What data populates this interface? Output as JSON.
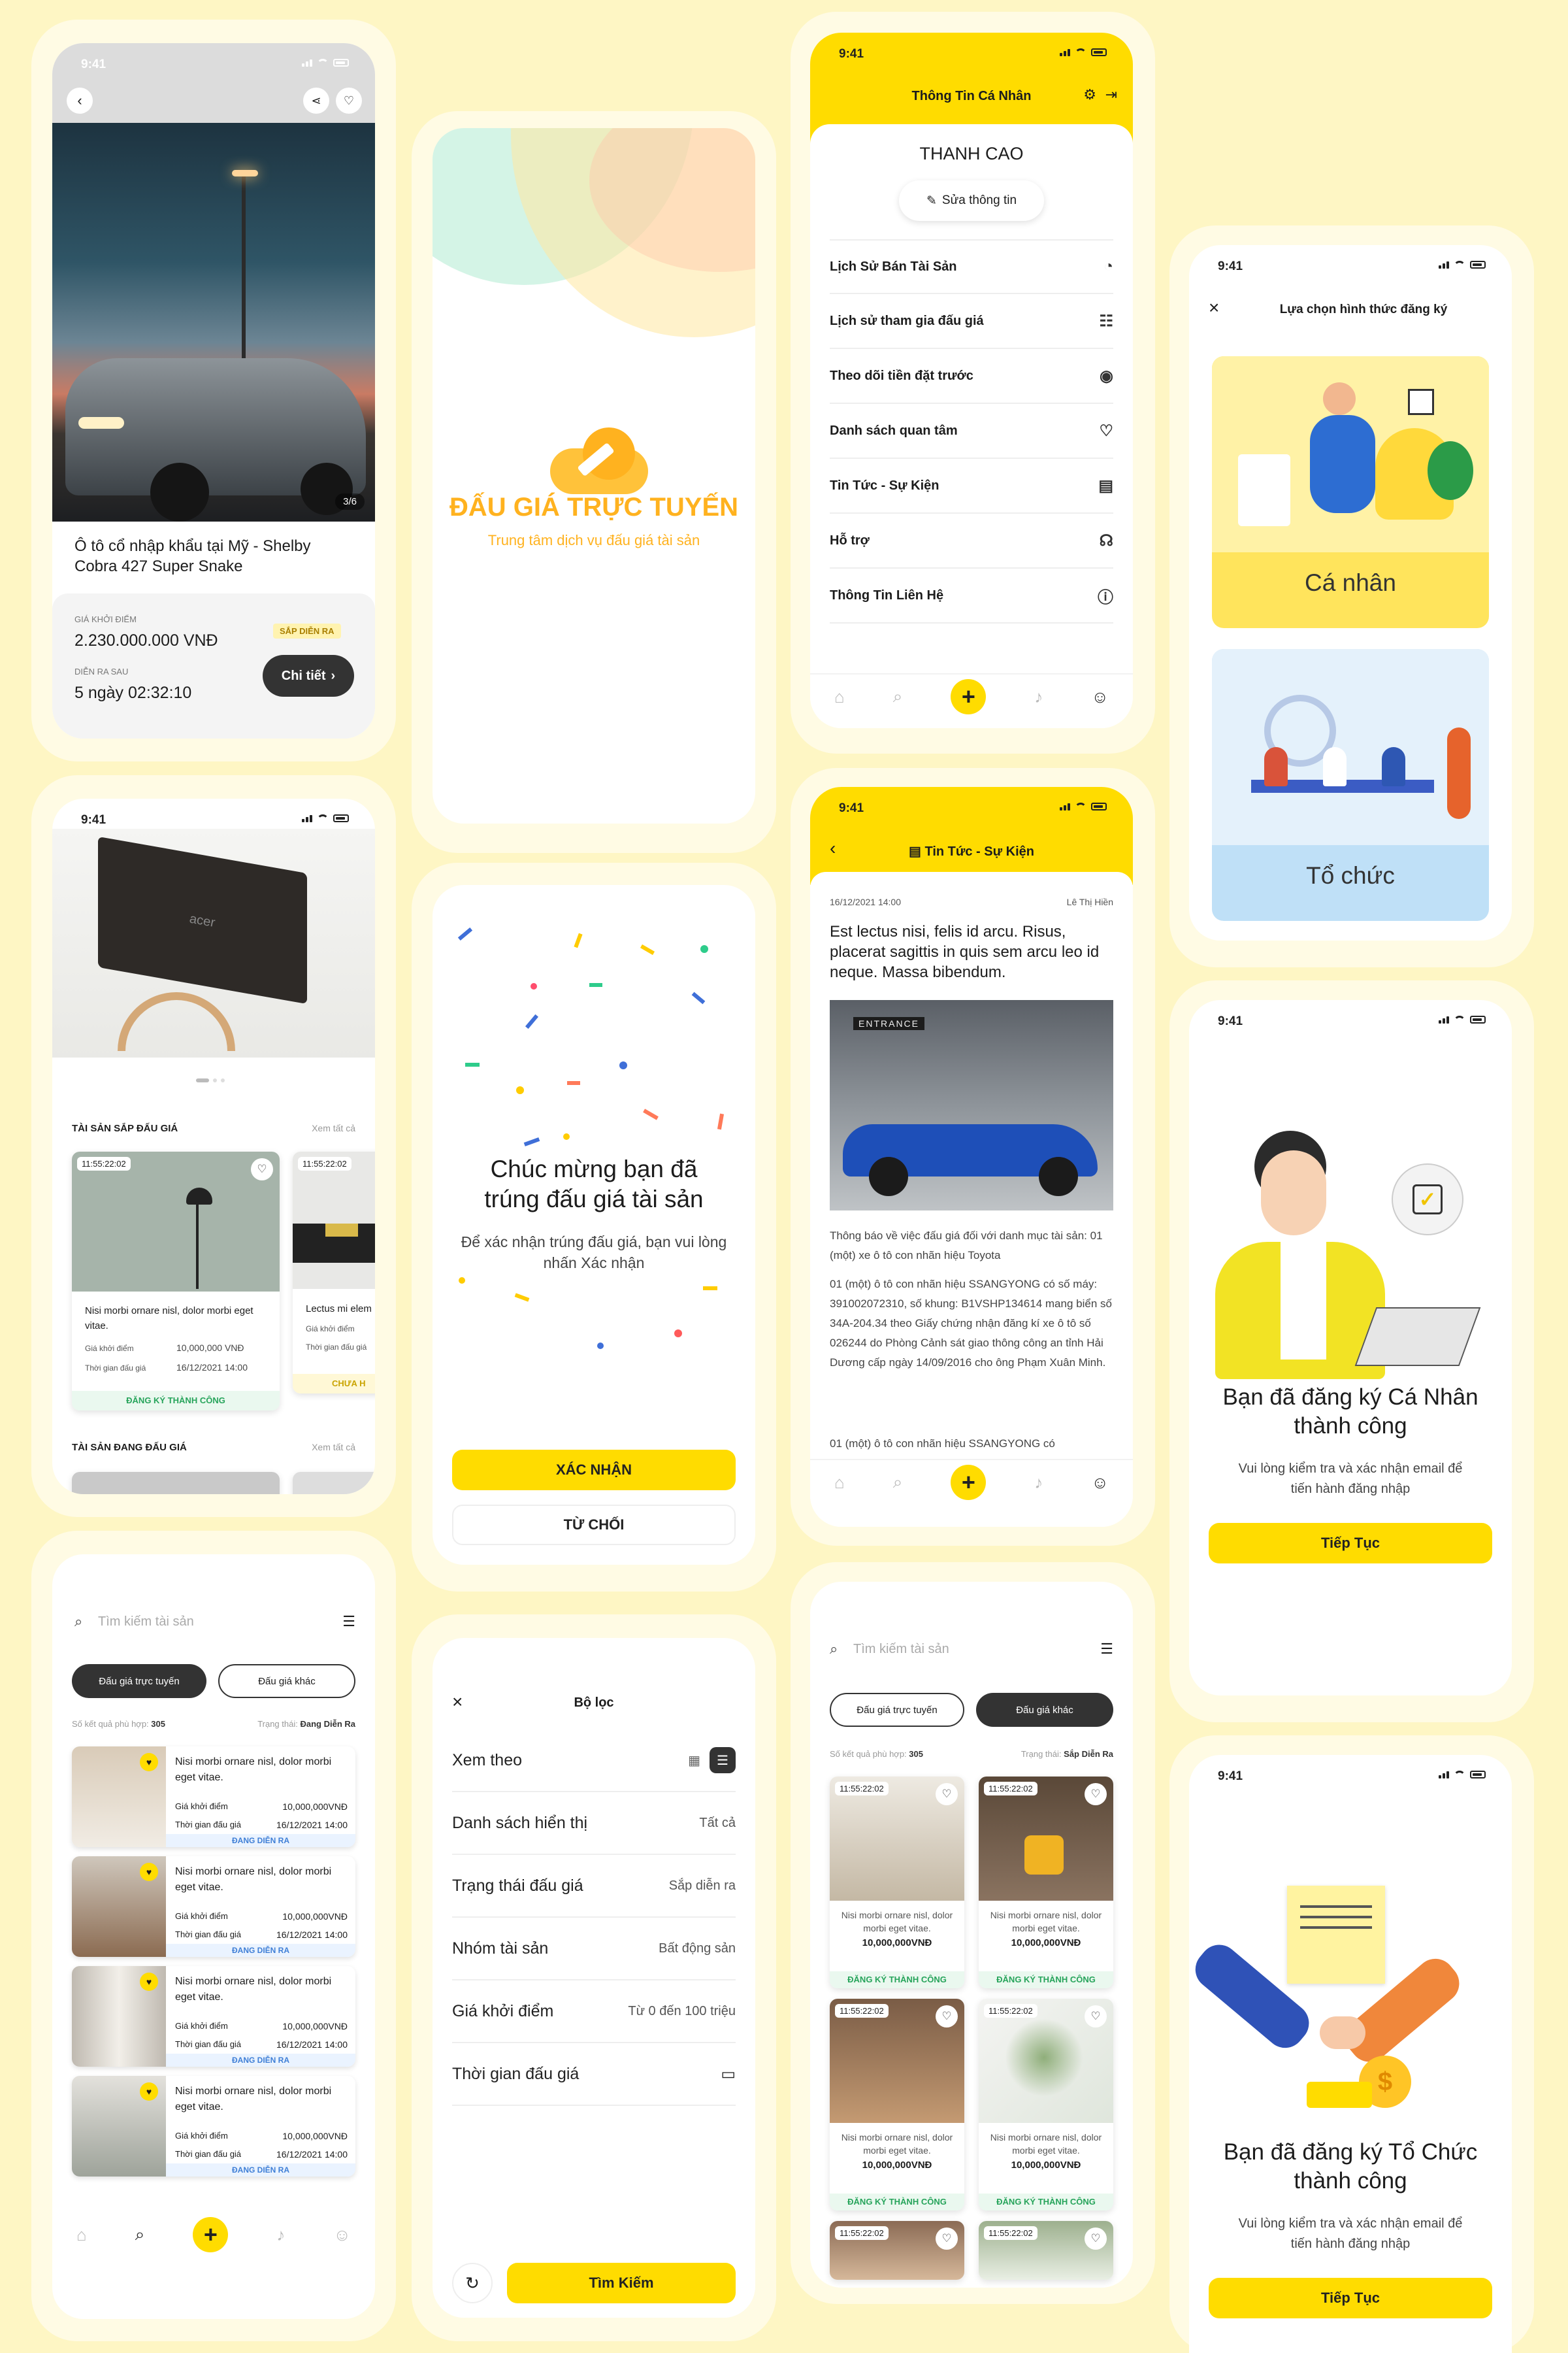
{
  "status_time": "9:41",
  "s1": {
    "counter": "3/6",
    "title": "Ô tô cổ nhập khẩu tại Mỹ - Shelby Cobra 427 Super Snake",
    "start_label": "GIÁ KHỞI ĐIỂM",
    "start_value": "2.230.000.000 VNĐ",
    "badge": "SẮP DIỄN RA",
    "after_label": "DIỄN RA SAU",
    "after_value": "5 ngày 02:32:10",
    "detail_btn": "Chi tiết"
  },
  "s2": {
    "brand": "acer",
    "section1": "TÀI SẢN SẮP ĐẤU GIÁ",
    "see_all": "Xem tất cả",
    "section2": "TÀI SẢN ĐANG ĐẤU GIÁ",
    "card1": {
      "time": "11:55:22:02",
      "title": "Nisi morbi ornare nisl, dolor morbi eget vitae.",
      "k1": "Giá khởi điểm",
      "v1": "10,000,000 VNĐ",
      "k2": "Thời gian đấu giá",
      "v2": "16/12/2021 14:00",
      "status": "ĐĂNG KÝ THÀNH CÔNG"
    },
    "card2": {
      "time": "11:55:22:02",
      "title": "Lectus mi elem",
      "k1": "Giá khởi điểm",
      "k2": "Thời gian đấu giá",
      "status": "CHƯA H"
    }
  },
  "s3": {
    "search_placeholder": "Tìm kiếm tài sản",
    "tab_active": "Đấu giá trực tuyến",
    "tab_other": "Đấu giá khác",
    "results_label": "Số kết quả phù hợp:",
    "results": "305",
    "state_label": "Trạng thái:",
    "state": "Đang Diễn Ra",
    "items": [
      {
        "title": "Nisi morbi ornare nisl, dolor morbi eget vitae.",
        "k1": "Giá khởi điểm",
        "v1": "10,000,000VNĐ",
        "k2": "Thời gian đấu giá",
        "v2": "16/12/2021 14:00",
        "status": "ĐANG DIỄN RA"
      },
      {
        "title": "Nisi morbi ornare nisl, dolor morbi eget vitae.",
        "k1": "Giá khởi điểm",
        "v1": "10,000,000VNĐ",
        "k2": "Thời gian đấu giá",
        "v2": "16/12/2021 14:00",
        "status": "ĐANG DIỄN RA"
      },
      {
        "title": "Nisi morbi ornare nisl, dolor morbi eget vitae.",
        "k1": "Giá khởi điểm",
        "v1": "10,000,000VNĐ",
        "k2": "Thời gian đấu giá",
        "v2": "16/12/2021 14:00",
        "status": "ĐANG DIỄN RA"
      },
      {
        "title": "Nisi morbi ornare nisl, dolor morbi eget vitae.",
        "k1": "Giá khởi điểm",
        "v1": "10,000,000VNĐ",
        "k2": "Thời gian đấu giá",
        "v2": "16/12/2021 14:00",
        "status": "ĐANG DIỄN RA"
      }
    ]
  },
  "s4": {
    "title": "ĐẤU GIÁ TRỰC TUYẾN",
    "subtitle": "Trung tâm dịch vụ đấu giá tài sản"
  },
  "s5": {
    "title": "Chúc mừng bạn đã trúng đấu giá tài sản",
    "text": "Để xác nhận trúng đấu giá, bạn vui lòng nhấn Xác nhận",
    "confirm": "XÁC NHẬN",
    "reject": "TỪ CHỐI"
  },
  "s6": {
    "title": "Bộ lọc",
    "rows": [
      {
        "label": "Xem theo",
        "value": ""
      },
      {
        "label": "Danh sách hiển thị",
        "value": "Tất cả"
      },
      {
        "label": "Trạng thái đấu giá",
        "value": "Sắp diễn ra"
      },
      {
        "label": "Nhóm tài sản",
        "value": "Bất động sản"
      },
      {
        "label": "Giá khởi điểm",
        "value": "Từ 0 đến 100 triệu"
      },
      {
        "label": "Thời gian đấu giá",
        "value": ""
      }
    ],
    "search_btn": "Tìm Kiếm"
  },
  "s7": {
    "header": "Thông Tin Cá Nhân",
    "name": "THANH CAO",
    "edit": "Sửa thông tin",
    "menu": [
      "Lịch Sử Bán Tài Sản",
      "Lịch sử tham gia đấu giá",
      "Theo dõi tiền đặt trước",
      "Danh sách quan tâm",
      "Tin Tức - Sự Kiện",
      "Hỗ trợ",
      "Thông Tin Liên Hệ"
    ]
  },
  "s8": {
    "header": "Tin Tức - Sự Kiện",
    "date": "16/12/2021 14:00",
    "author": "Lê Thị Hiền",
    "title": "Est lectus nisi, felis id arcu. Risus, placerat sagittis in quis sem arcu leo id neque. Massa bibendum.",
    "sign": "ENTRANCE",
    "p1": "Thông báo về việc đấu giá đối với danh mục tài sản: 01 (một) xe ô tô con nhãn hiệu Toyota",
    "p2": "01 (một) ô tô con nhãn hiệu SSANGYONG có số máy: 391002072310, số khung: B1VSHP134614 mang biển số 34A-204.34 theo Giấy chứng nhận đăng kí xe ô tô số 026244 do Phòng Cảnh sát giao thông công an tỉnh Hải Dương cấp ngày 14/09/2016 cho ông Phạm Xuân Minh.",
    "p3": "01 (một) ô tô con nhãn hiệu SSANGYONG có"
  },
  "s9": {
    "search_placeholder": "Tìm kiếm tài sản",
    "tab_other": "Đấu giá trực tuyến",
    "tab_active": "Đấu giá khác",
    "results_label": "Số kết quả phù hợp:",
    "results": "305",
    "state_label": "Trạng thái:",
    "state": "Sắp Diễn Ra",
    "grid": [
      {
        "time": "11:55:22:02",
        "title": "Nisi morbi ornare nisl, dolor morbi eget vitae.",
        "price": "10,000,000VNĐ",
        "status": "ĐĂNG KÝ THÀNH CÔNG"
      },
      {
        "time": "11:55:22:02",
        "title": "Nisi morbi ornare nisl, dolor morbi eget vitae.",
        "price": "10,000,000VNĐ",
        "status": "ĐĂNG KÝ THÀNH CÔNG"
      },
      {
        "time": "11:55:22:02",
        "title": "Nisi morbi ornare nisl, dolor morbi eget vitae.",
        "price": "10,000,000VNĐ",
        "status": "ĐĂNG KÝ THÀNH CÔNG"
      },
      {
        "time": "11:55:22:02",
        "title": "Nisi morbi ornare nisl, dolor morbi eget vitae.",
        "price": "10,000,000VNĐ",
        "status": "ĐĂNG KÝ THÀNH CÔNG"
      },
      {
        "time": "11:55:22:02"
      },
      {
        "time": "11:55:22:02"
      }
    ]
  },
  "s10": {
    "title": "Lựa chọn hình thức đăng ký",
    "personal": "Cá nhân",
    "org": "Tổ chức"
  },
  "s11": {
    "title": "Bạn đã đăng ký Cá Nhân thành công",
    "text": "Vui lòng kiểm tra và xác nhận email để tiến hành đăng nhập",
    "btn": "Tiếp Tục"
  },
  "s12": {
    "title": "Bạn đã đăng ký Tổ Chức thành công",
    "text": "Vui lòng kiểm tra và xác nhận email để tiến hành đăng nhập",
    "btn": "Tiếp Tục"
  }
}
